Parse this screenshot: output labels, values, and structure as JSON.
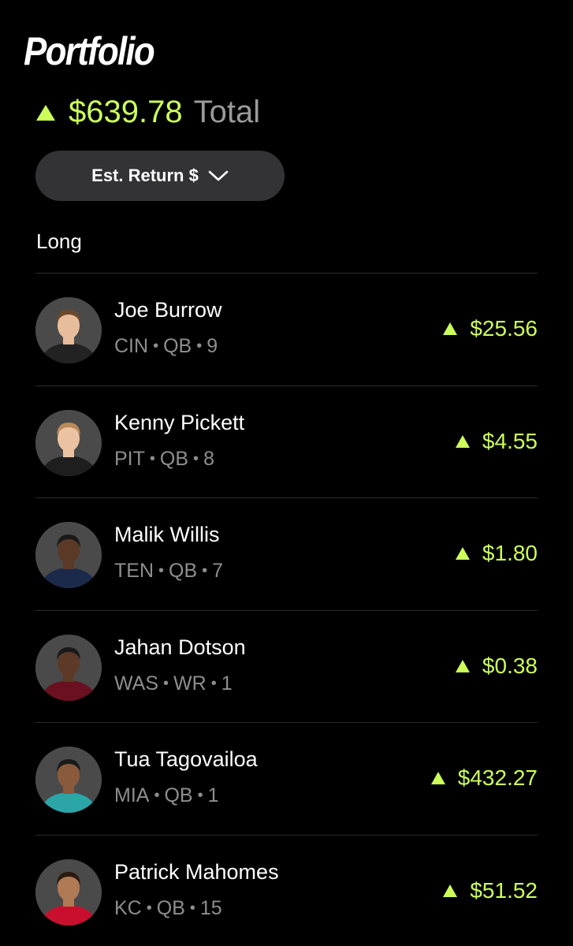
{
  "page": {
    "title": "Portfolio"
  },
  "summary": {
    "total_value": "$639.78",
    "total_label": "Total",
    "trend": "up"
  },
  "dropdown": {
    "label": "Est. Return $"
  },
  "section": {
    "label": "Long"
  },
  "colors": {
    "accent_green": "#ccff5a",
    "muted_text": "#8e8e8e",
    "button_bg": "#333335",
    "background": "#000000"
  },
  "players": [
    {
      "name": "Joe Burrow",
      "team": "CIN",
      "position": "QB",
      "number": "9",
      "return": "$25.56",
      "jersey_color": "#222222",
      "skin": "#e8bd9c",
      "hair": "#6e4a2a"
    },
    {
      "name": "Kenny Pickett",
      "team": "PIT",
      "position": "QB",
      "number": "8",
      "return": "$4.55",
      "jersey_color": "#1e1e1e",
      "skin": "#ebc2a2",
      "hair": "#b98a58"
    },
    {
      "name": "Malik Willis",
      "team": "TEN",
      "position": "QB",
      "number": "7",
      "return": "$1.80",
      "jersey_color": "#1b2a4a",
      "skin": "#5a3a26",
      "hair": "#1a1a1a"
    },
    {
      "name": "Jahan Dotson",
      "team": "WAS",
      "position": "WR",
      "number": "1",
      "return": "$0.38",
      "jersey_color": "#6b1020",
      "skin": "#5c3a27",
      "hair": "#1a1a1a"
    },
    {
      "name": "Tua Tagovailoa",
      "team": "MIA",
      "position": "QB",
      "number": "1",
      "return": "$432.27",
      "jersey_color": "#2ca5a8",
      "skin": "#8a5a3c",
      "hair": "#1a1a1a"
    },
    {
      "name": "Patrick Mahomes",
      "team": "KC",
      "position": "QB",
      "number": "15",
      "return": "$51.52",
      "jersey_color": "#c8102e",
      "skin": "#b07a55",
      "hair": "#2a1a10"
    }
  ]
}
